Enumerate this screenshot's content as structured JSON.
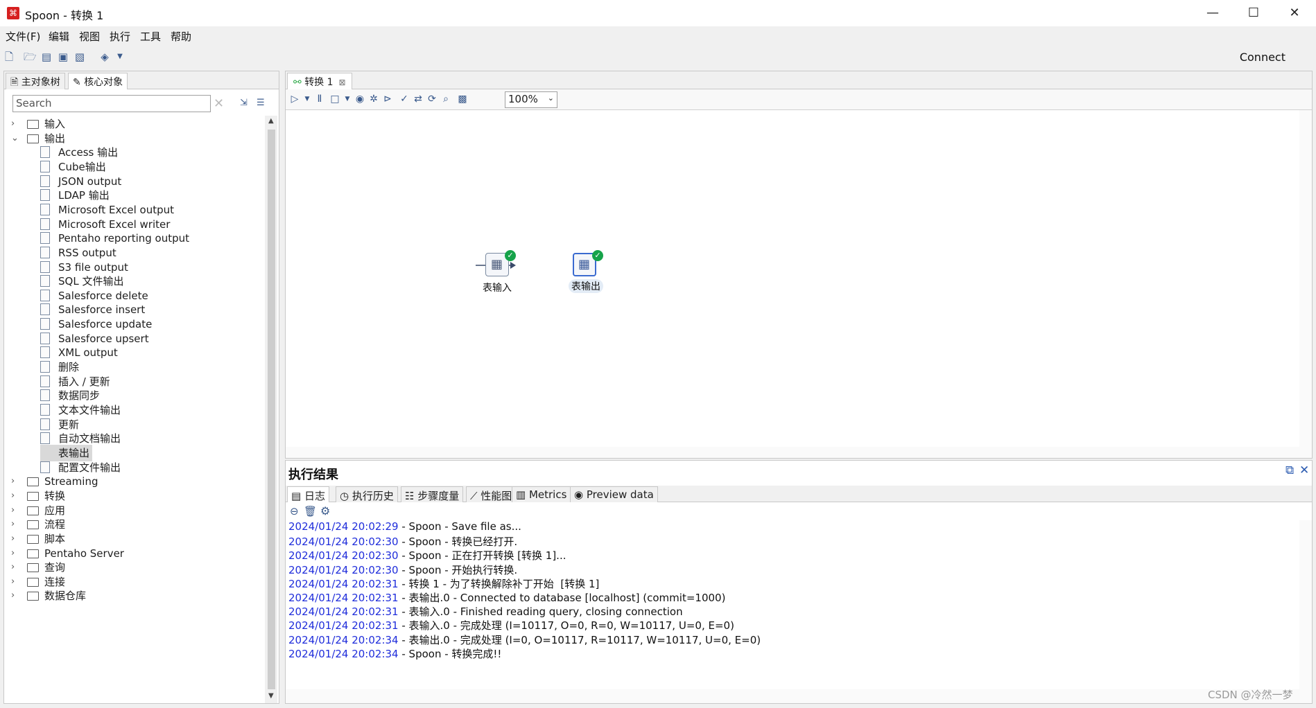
{
  "window": {
    "title": "Spoon - 转换 1",
    "minimize": "—",
    "maximize": "☐",
    "close": "✕"
  },
  "menu": [
    "文件(F)",
    "编辑",
    "视图",
    "执行",
    "工具",
    "帮助"
  ],
  "toolbar": {
    "connect_label": "Connect"
  },
  "left_panel": {
    "tabs": [
      "主对象树",
      "核心对象"
    ],
    "search_placeholder": "Search",
    "tree": [
      {
        "type": "folder",
        "label": "输入",
        "expanded": false
      },
      {
        "type": "folder",
        "label": "输出",
        "expanded": true
      },
      {
        "type": "leaf",
        "label": "Access 输出"
      },
      {
        "type": "leaf",
        "label": "Cube输出"
      },
      {
        "type": "leaf",
        "label": "JSON output"
      },
      {
        "type": "leaf",
        "label": "LDAP 输出"
      },
      {
        "type": "leaf",
        "label": "Microsoft Excel output"
      },
      {
        "type": "leaf",
        "label": "Microsoft Excel writer"
      },
      {
        "type": "leaf",
        "label": "Pentaho reporting output"
      },
      {
        "type": "leaf",
        "label": "RSS output"
      },
      {
        "type": "leaf",
        "label": "S3 file output"
      },
      {
        "type": "leaf",
        "label": "SQL 文件输出"
      },
      {
        "type": "leaf",
        "label": "Salesforce delete"
      },
      {
        "type": "leaf",
        "label": "Salesforce insert"
      },
      {
        "type": "leaf",
        "label": "Salesforce update"
      },
      {
        "type": "leaf",
        "label": "Salesforce upsert"
      },
      {
        "type": "leaf",
        "label": "XML output"
      },
      {
        "type": "leaf",
        "label": "删除"
      },
      {
        "type": "leaf",
        "label": "插入 / 更新"
      },
      {
        "type": "leaf",
        "label": "数据同步"
      },
      {
        "type": "leaf",
        "label": "文本文件输出"
      },
      {
        "type": "leaf",
        "label": "更新"
      },
      {
        "type": "leaf",
        "label": "自动文档输出"
      },
      {
        "type": "leaf",
        "label": "表输出",
        "selected": true
      },
      {
        "type": "leaf",
        "label": "配置文件输出"
      },
      {
        "type": "folder",
        "label": "Streaming",
        "expanded": false
      },
      {
        "type": "folder",
        "label": "转换",
        "expanded": false
      },
      {
        "type": "folder",
        "label": "应用",
        "expanded": false
      },
      {
        "type": "folder",
        "label": "流程",
        "expanded": false
      },
      {
        "type": "folder",
        "label": "脚本",
        "expanded": false
      },
      {
        "type": "folder",
        "label": "Pentaho Server",
        "expanded": false
      },
      {
        "type": "folder",
        "label": "查询",
        "expanded": false
      },
      {
        "type": "folder",
        "label": "连接",
        "expanded": false
      },
      {
        "type": "folder",
        "label": "数据仓库",
        "expanded": false
      }
    ]
  },
  "editor": {
    "tab_label": "转换 1",
    "zoom": "100%",
    "steps": [
      {
        "label": "表输入",
        "status": "ok"
      },
      {
        "label": "表输出",
        "status": "ok"
      }
    ]
  },
  "results": {
    "title": "执行结果",
    "tabs": [
      "日志",
      "执行历史",
      "步骤度量",
      "性能图",
      "Metrics",
      "Preview data"
    ],
    "log": [
      {
        "time": "2024/01/24 20:02:29",
        "text": " - Spoon - Save file as..."
      },
      {
        "time": "2024/01/24 20:02:30",
        "text": " - Spoon - 转换已经打开."
      },
      {
        "time": "2024/01/24 20:02:30",
        "text": " - Spoon - 正在打开转换 [转换 1]..."
      },
      {
        "time": "2024/01/24 20:02:30",
        "text": " - Spoon - 开始执行转换."
      },
      {
        "time": "2024/01/24 20:02:31",
        "text": " - 转换 1 - 为了转换解除补丁开始  [转换 1]"
      },
      {
        "time": "2024/01/24 20:02:31",
        "text": " - 表输出.0 - Connected to database [localhost] (commit=1000)"
      },
      {
        "time": "2024/01/24 20:02:31",
        "text": " - 表输入.0 - Finished reading query, closing connection"
      },
      {
        "time": "2024/01/24 20:02:31",
        "text": " - 表输入.0 - 完成处理 (I=10117, O=0, R=0, W=10117, U=0, E=0)"
      },
      {
        "time": "2024/01/24 20:02:34",
        "text": " - 表输出.0 - 完成处理 (I=0, O=10117, R=10117, W=10117, U=0, E=0)"
      },
      {
        "time": "2024/01/24 20:02:34",
        "text": " - Spoon - 转换完成!!"
      }
    ]
  },
  "watermark": "CSDN @冷然一梦",
  "colors": {
    "log_time": "#1f2ddb",
    "ok": "#16a34a",
    "app_icon": "#d62020"
  }
}
